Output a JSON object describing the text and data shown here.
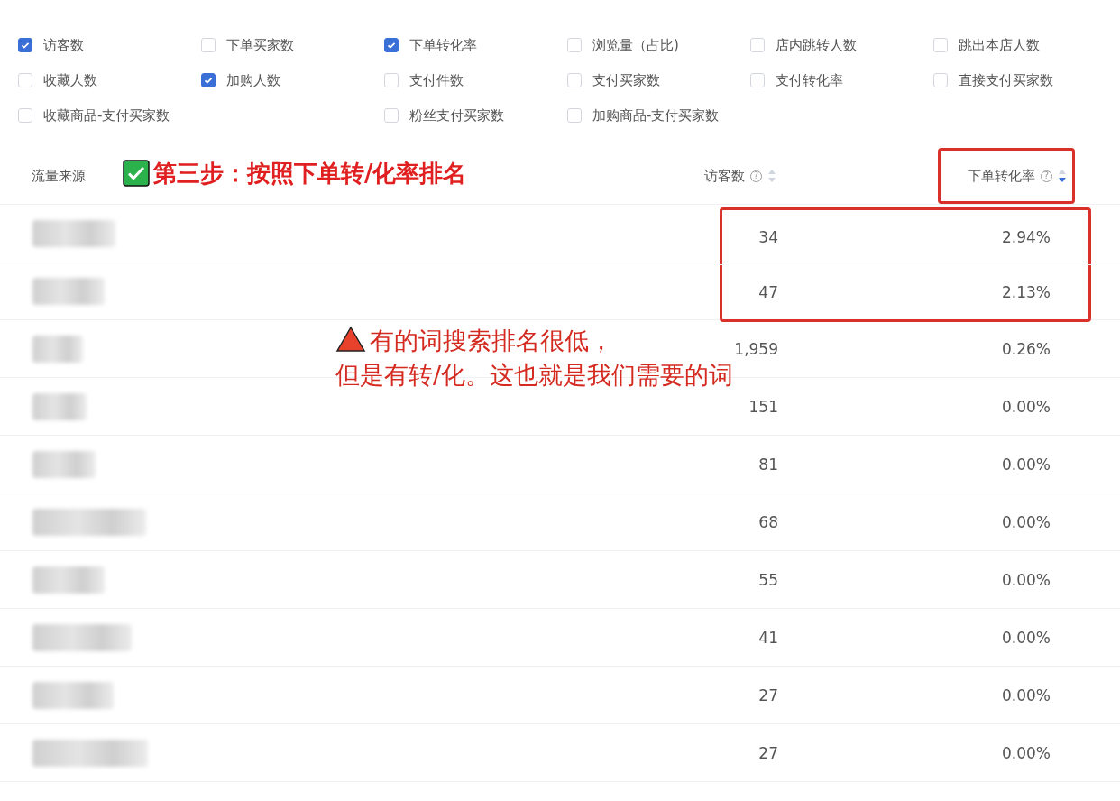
{
  "filters": [
    {
      "kind": "checkbox",
      "label": "访客数",
      "checked": true
    },
    {
      "kind": "checkbox",
      "label": "下单买家数",
      "checked": false
    },
    {
      "kind": "checkbox",
      "label": "下单转化率",
      "checked": true
    },
    {
      "kind": "checkbox",
      "label": "浏览量（占比)",
      "checked": false
    },
    {
      "kind": "checkbox",
      "label": "店内跳转人数",
      "checked": false
    },
    {
      "kind": "checkbox",
      "label": "跳出本店人数",
      "checked": false
    },
    {
      "kind": "checkbox",
      "label": "收藏人数",
      "checked": false
    },
    {
      "kind": "checkbox",
      "label": "加购人数",
      "checked": true
    },
    {
      "kind": "checkbox",
      "label": "支付件数",
      "checked": false
    },
    {
      "kind": "checkbox",
      "label": "支付买家数",
      "checked": false
    },
    {
      "kind": "checkbox",
      "label": "支付转化率",
      "checked": false
    },
    {
      "kind": "checkbox",
      "label": "直接支付买家数",
      "checked": false
    },
    {
      "kind": "checkbox",
      "label": "收藏商品-支付买家数",
      "checked": false
    },
    {
      "kind": "empty"
    },
    {
      "kind": "checkbox",
      "label": "粉丝支付买家数",
      "checked": false
    },
    {
      "kind": "checkbox",
      "label": "加购商品-支付买家数",
      "checked": false
    }
  ],
  "step_note": {
    "text": "第三步：按照下单转/化率排名"
  },
  "table": {
    "columns": [
      {
        "label": "流量来源",
        "highlighted": false
      },
      {
        "label": "访客数",
        "help": "?",
        "sorted_desc": false,
        "highlighted": false
      },
      {
        "label": "下单转化率",
        "help": "?",
        "sorted_desc": true,
        "highlighted": true
      }
    ],
    "rows": [
      {
        "source_blurred": true,
        "visitors": "34",
        "rate": "2.94%",
        "highlighted": true
      },
      {
        "source_blurred": true,
        "visitors": "47",
        "rate": "2.13%",
        "highlighted": true
      },
      {
        "source_blurred": true,
        "visitors": "1,959",
        "rate": "0.26%",
        "highlighted": false
      },
      {
        "source_blurred": true,
        "visitors": "151",
        "rate": "0.00%",
        "highlighted": false
      },
      {
        "source_blurred": true,
        "visitors": "81",
        "rate": "0.00%",
        "highlighted": false
      },
      {
        "source_blurred": true,
        "visitors": "68",
        "rate": "0.00%",
        "highlighted": false
      },
      {
        "source_blurred": true,
        "visitors": "55",
        "rate": "0.00%",
        "highlighted": false
      },
      {
        "source_blurred": true,
        "visitors": "41",
        "rate": "0.00%",
        "highlighted": false
      },
      {
        "source_blurred": true,
        "visitors": "27",
        "rate": "0.00%",
        "highlighted": false
      },
      {
        "source_blurred": true,
        "visitors": "27",
        "rate": "0.00%",
        "highlighted": false
      }
    ]
  },
  "remark": {
    "lines": [
      "有的词搜索排名很低，",
      "但是有转/化。这也就是我们需要的词"
    ]
  }
}
